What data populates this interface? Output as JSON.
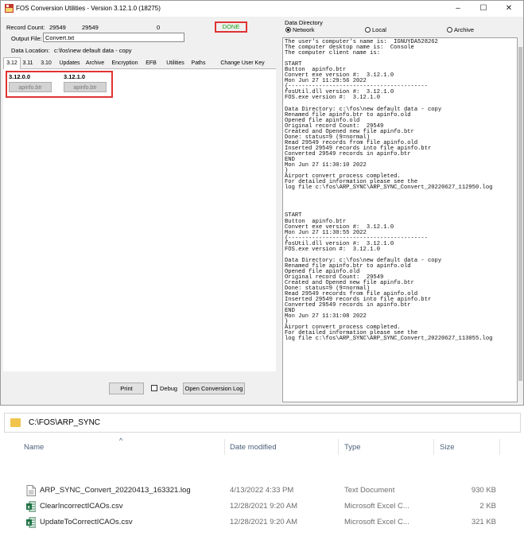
{
  "window": {
    "title": "FOS Conversion Utilities - Version 3.12.1.0 (18275)",
    "controls": {
      "minimize": "–",
      "maximize": "☐",
      "close": "✕"
    }
  },
  "left": {
    "record_count_label": "Record Count:",
    "record_count_1": "29549",
    "record_count_2": "29549",
    "record_count_3": "0",
    "status": "DONE",
    "output_file_label": "Output File:",
    "output_file_value": "Convert.txt",
    "data_location_label": "Data Location:",
    "data_location_value": "c:\\fos\\new default data - copy",
    "tabs": [
      "3.12",
      "3.11",
      "3.10",
      "Updates",
      "Archive",
      "Encryption",
      "EFB",
      "Utilities",
      "Paths",
      "Change User Key"
    ],
    "versions": [
      {
        "header": "3.12.0.0",
        "button": "apinfo.btr"
      },
      {
        "header": "3.12.1.0",
        "button": "apinfo.btr"
      }
    ],
    "print_label": "Print",
    "debug_label": "Debug",
    "open_log_label": "Open Conversion Log"
  },
  "right": {
    "data_directory_label": "Data Directory",
    "radio_network": "Network",
    "radio_local": "Local",
    "radio_archive": "Archive",
    "log_text": "The user's computer's name is:  IGNUYDA528262\nThe computer desktop name is:  Console\nThe computer client name is:\n\nSTART\nButton  apinfo.btr\nConvert exe version #:  3.12.1.0\nMon Jun 27 11:29:56 2022\n{-----------------------------------------\nfosUtil.dll version #:  3.12.1.0\nFOS.exe version #:  3.12.1.0\n\nData Directory: c:\\fos\\new default data - copy\nRenamed file apinfo.btr to apinfo.old\nOpened file apinfo.old\nOriginal record Count:  29549\nCreated and Opened new file apinfo.btr\nDone: status=9 (9=normal)\nRead 29549 records from file apinfo.old\nInserted 29549 records into file apinfo.btr\nConverted 29549 records in apinfo.btr\nEND\nMon Jun 27 11:30:10 2022\n}\nAirport convert process completed.\nFor detailed information please see the\nlog file c:\\fos\\ARP_SYNC\\ARP_SYNC_Convert_20220627_112950.log\n\n\n\n\nSTART\nButton  apinfo.btr\nConvert exe version #:  3.12.1.0\nMon Jun 27 11:30:55 2022\n{-----------------------------------------\nfosUtil.dll version #:  3.12.1.0\nFOS.exe version #:  3.12.1.0\n\nData Directory: c:\\fos\\new default data - copy\nRenamed file apinfo.btr to apinfo.old\nOpened file apinfo.old\nOriginal record Count:  29549\nCreated and Opened new file apinfo.btr\nDone: status=9 (9=normal)\nRead 29549 records from file apinfo.old\nInserted 29549 records into file apinfo.btr\nConverted 29549 records in apinfo.btr\nEND\nMon Jun 27 11:31:08 2022\n}\nAirport convert process completed.\nFor detailed information please see the\nlog file c:\\fos\\ARP_SYNC\\ARP_SYNC_Convert_20220627_113055.log"
  },
  "explorer": {
    "path": "C:\\FOS\\ARP_SYNC",
    "columns": {
      "name": "Name",
      "date": "Date modified",
      "type": "Type",
      "size": "Size"
    },
    "files": [
      {
        "name": "ARP_SYNC_Convert_20220413_163321.log",
        "date": "4/13/2022 4:33 PM",
        "type": "Text Document",
        "size": "930 KB",
        "icon": "text-file-icon"
      },
      {
        "name": "ClearIncorrectICAOs.csv",
        "date": "12/28/2021 9:20 AM",
        "type": "Microsoft Excel C...",
        "size": "2 KB",
        "icon": "excel-file-icon"
      },
      {
        "name": "UpdateToCorrectICAOs.csv",
        "date": "12/28/2021 9:20 AM",
        "type": "Microsoft Excel C...",
        "size": "321 KB",
        "icon": "excel-file-icon"
      }
    ]
  },
  "colors": {
    "status_green": "#19a019",
    "highlight_red": "#e03333",
    "folder_yellow": "#f1c44e",
    "excel_green": "#1f7244"
  }
}
